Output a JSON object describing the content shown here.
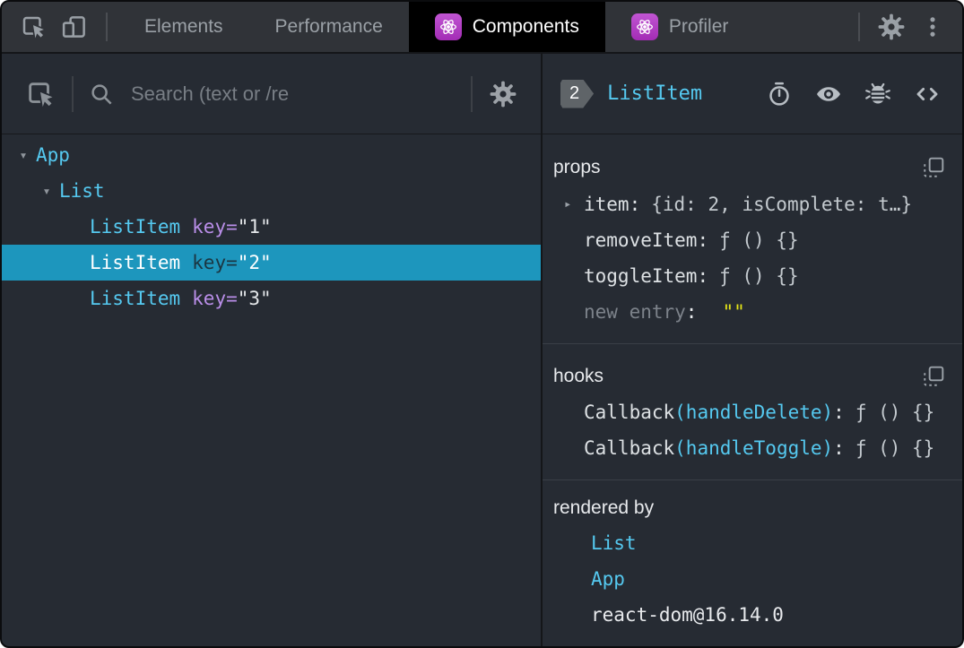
{
  "topbar": {
    "tabs": [
      {
        "label": "Elements"
      },
      {
        "label": "Performance"
      },
      {
        "label": "Components",
        "active": true,
        "has_react_icon": true
      },
      {
        "label": "Profiler",
        "has_react_icon": true
      }
    ]
  },
  "left": {
    "toolbar": {
      "search_placeholder": "Search (text or /re"
    },
    "tree": {
      "rows": [
        {
          "name": "App",
          "depth": 0,
          "expanded": true
        },
        {
          "name": "List",
          "depth": 1,
          "expanded": true
        },
        {
          "name": "ListItem",
          "attr": "key=",
          "value": "\"1\"",
          "depth": 2
        },
        {
          "name": "ListItem",
          "attr": "key=",
          "value": "\"2\"",
          "depth": 2,
          "selected": true
        },
        {
          "name": "ListItem",
          "attr": "key=",
          "value": "\"3\"",
          "depth": 2
        }
      ]
    }
  },
  "right": {
    "header": {
      "badge": "2",
      "title": "ListItem"
    },
    "props": {
      "title": "props",
      "rows": [
        {
          "label": "item",
          "sep": ":",
          "value": "{id: 2, isComplete: t…}",
          "expandable": true
        },
        {
          "label": "removeItem",
          "sep": ":",
          "value": "ƒ () {}"
        },
        {
          "label": "toggleItem",
          "sep": ":",
          "value": "ƒ () {}"
        }
      ],
      "new_entry": {
        "label": "new entry",
        "sep": ":",
        "value": "\"\""
      }
    },
    "hooks": {
      "title": "hooks",
      "rows": [
        {
          "fn": "Callback",
          "hook": "(handleDelete)",
          "sep": ":",
          "value": "ƒ () {}"
        },
        {
          "fn": "Callback",
          "hook": "(handleToggle)",
          "sep": ":",
          "value": "ƒ () {}"
        }
      ]
    },
    "rendered_by": {
      "title": "rendered by",
      "items": [
        "List",
        "App",
        "react-dom@16.14.0"
      ]
    }
  },
  "glyphs": {
    "expanded": "▾",
    "collapsed": "▸"
  },
  "icons": {
    "topbar": [
      "inspect-icon",
      "device-toolbar-icon",
      "react-logo-icon",
      "gear-icon",
      "kebab-menu-icon"
    ],
    "left_toolbar": [
      "inspect-icon",
      "search-icon",
      "gear-icon"
    ],
    "right_header": [
      "stopwatch-icon",
      "eye-icon",
      "bug-icon",
      "code-icon"
    ],
    "sections": [
      "copy-icon"
    ]
  },
  "colors": {
    "component_cyan": "#55c9f0",
    "key_purple": "#b98ee8",
    "selection_blue": "#1d96bd",
    "string_yellow": "#e5e516",
    "react_purple": "#a32cb5",
    "active_tab_bg": "#000000",
    "panel_bg": "#262b33",
    "topbar_bg": "#303338"
  }
}
